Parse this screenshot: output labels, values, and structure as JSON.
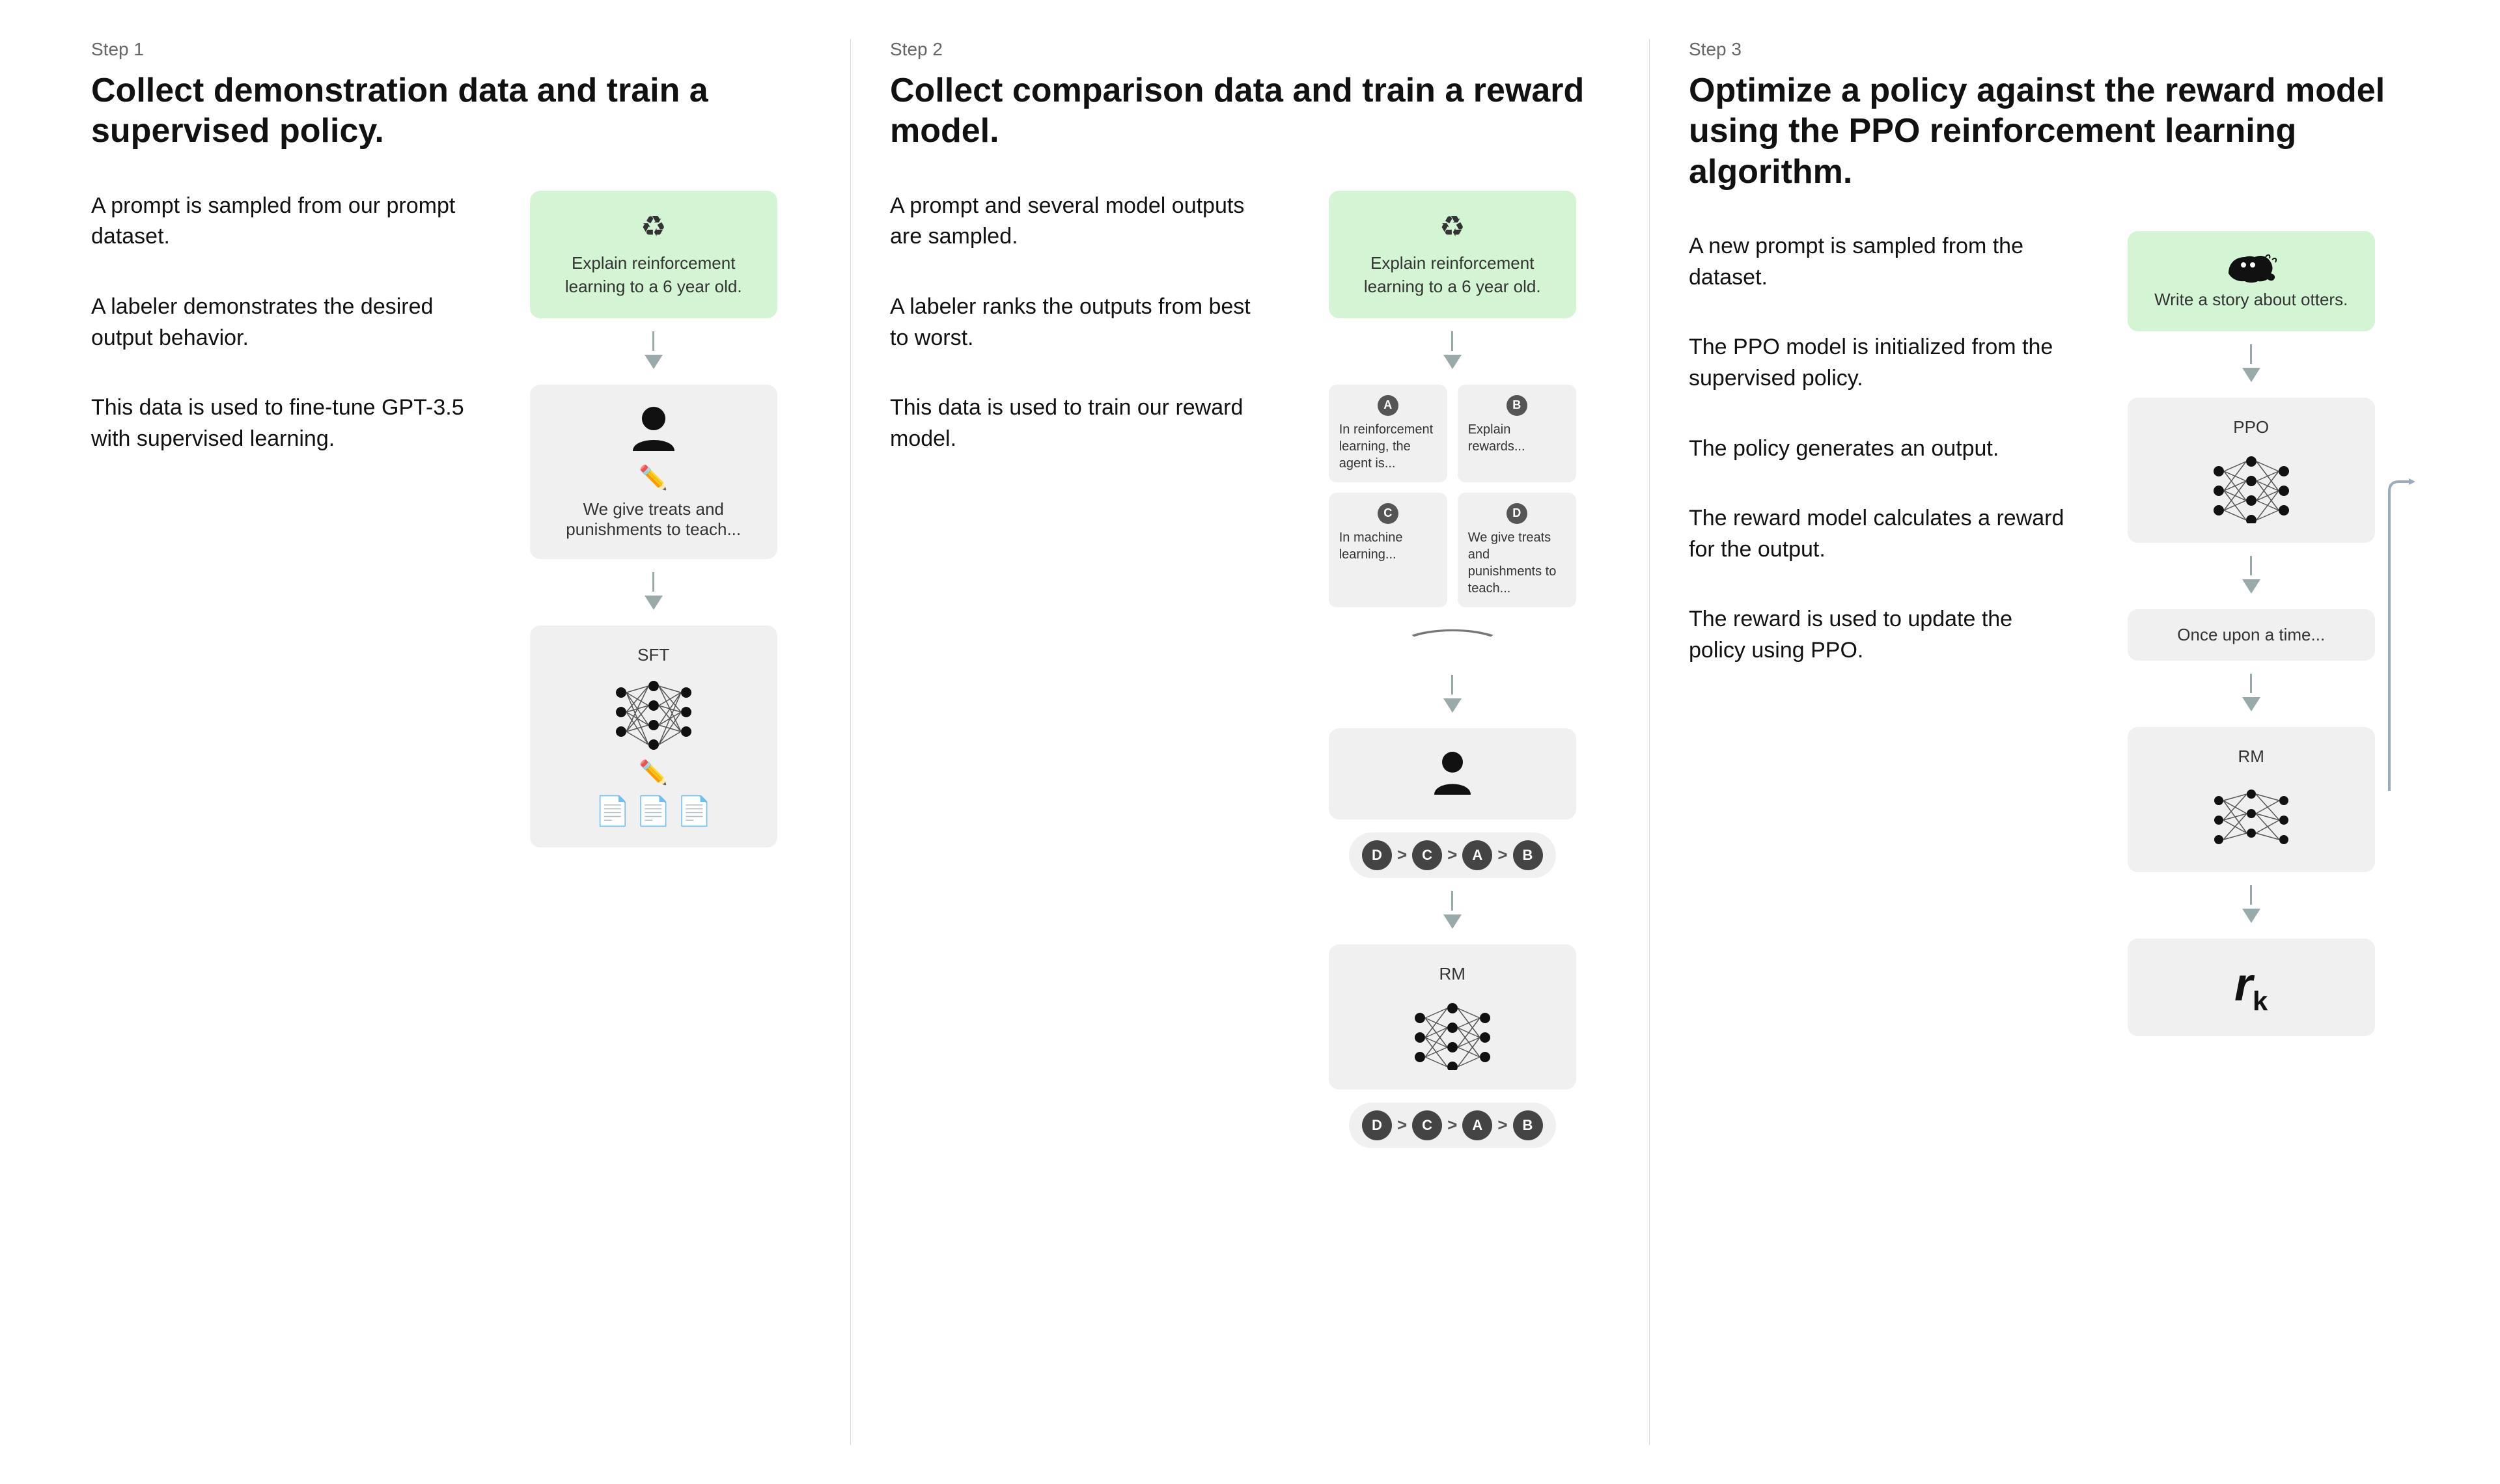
{
  "steps": [
    {
      "label": "Step 1",
      "title": "Collect demonstration data and train a supervised policy.",
      "descriptions": [
        "A prompt is sampled from our prompt dataset.",
        "A labeler demonstrates the desired output behavior.",
        "This data is used to fine-tune GPT-3.5 with supervised learning."
      ],
      "prompt_box": {
        "text": "Explain reinforcement learning to a 6 year old."
      },
      "gray_box_label": "We give treats and punishments to teach...",
      "model_label": "SFT"
    },
    {
      "label": "Step 2",
      "title": "Collect comparison data and train a reward model.",
      "descriptions": [
        "A prompt and several model outputs are sampled.",
        "A labeler ranks the outputs from best to worst.",
        "This data is used to train our reward model."
      ],
      "prompt_box": {
        "text": "Explain reinforcement learning to a 6 year old."
      },
      "comparison_cells": [
        {
          "label": "A",
          "text": "In reinforcement learning, the agent is..."
        },
        {
          "label": "B",
          "text": "Explain rewards..."
        },
        {
          "label": "C",
          "text": "In machine learning..."
        },
        {
          "label": "D",
          "text": "We give treats and punishments to teach..."
        }
      ],
      "ranking": [
        "D",
        ">",
        "C",
        ">",
        "A",
        ">",
        "B"
      ],
      "model_label": "RM"
    },
    {
      "label": "Step 3",
      "title": "Optimize a policy against the reward model using the PPO reinforcement learning algorithm.",
      "descriptions": [
        "A new prompt is sampled from the dataset.",
        "The PPO model is initialized from the supervised policy.",
        "The policy generates an output.",
        "The reward model calculates a reward for the output.",
        "The reward is used to update the policy using PPO."
      ],
      "prompt_box": {
        "text": "Write a story about otters."
      },
      "ppo_label": "PPO",
      "output_text": "Once upon a time...",
      "rm_label": "RM",
      "reward_label": "rk"
    }
  ]
}
